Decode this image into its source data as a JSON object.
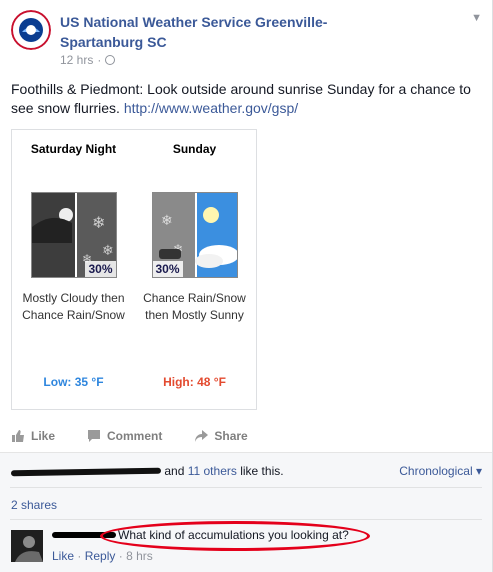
{
  "post": {
    "page_name": "US National Weather Service Greenville-Spartanburg SC",
    "time": "12 hrs",
    "text": "Foothills & Piedmont: Look outside around sunrise Sunday for a chance to see snow flurries.",
    "link": "http://www.weather.gov/gsp/"
  },
  "forecast": {
    "periods": [
      {
        "day": "Saturday Night",
        "chance": "30%",
        "desc": "Mostly Cloudy then Chance Rain/Snow",
        "temp": "Low: 35 °F"
      },
      {
        "day": "Sunday",
        "chance": "30%",
        "desc": "Chance Rain/Snow then Mostly Sunny",
        "temp": "High: 48 °F"
      }
    ]
  },
  "actions": {
    "like": "Like",
    "comment": "Comment",
    "share": "Share"
  },
  "ufi": {
    "likes_suffix_pre": "and",
    "others_link": "11 others",
    "likes_suffix_post": "like this.",
    "order": "Chronological",
    "shares": "2 shares"
  },
  "comment": {
    "text": "What kind of accumulations you looking at?",
    "like": "Like",
    "reply": "Reply",
    "time": "8 hrs"
  },
  "colors": {
    "link": "#3b5998",
    "low": "#2e86de",
    "high": "#e34a2f",
    "annotation": "#e4001b"
  }
}
